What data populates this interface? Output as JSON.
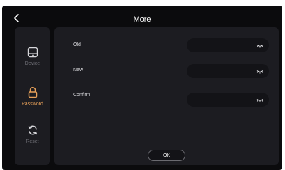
{
  "header": {
    "title": "More"
  },
  "sidebar": {
    "items": [
      {
        "label": "Device",
        "icon": "device-icon"
      },
      {
        "label": "Password",
        "icon": "lock-icon",
        "active": true
      },
      {
        "label": "Reset",
        "icon": "refresh-icon"
      }
    ]
  },
  "form": {
    "old_label": "Old",
    "new_label": "New",
    "confirm_label": "Confirm",
    "old_value": "",
    "new_value": "",
    "confirm_value": "",
    "ok_label": "OK"
  },
  "colors": {
    "accent": "#e8a15a",
    "background": "#0b0b0d",
    "panel": "#1c1c21",
    "input": "#131317"
  }
}
